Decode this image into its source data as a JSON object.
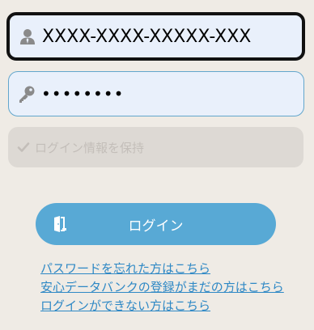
{
  "login_form": {
    "user_id": {
      "value": "XXXX-XXXX-XXXXX-XXX",
      "icon": "user-icon"
    },
    "password": {
      "value": "••••••••",
      "icon": "key-icon"
    },
    "remember": {
      "label": "ログイン情報を保持",
      "checked": false,
      "icon": "check-icon"
    },
    "submit": {
      "label": "ログイン",
      "icon": "door-icon"
    }
  },
  "help_links": [
    {
      "label": "パスワードを忘れた方はこちら"
    },
    {
      "label": "安心データバンクの登録がまだの方はこちら"
    },
    {
      "label": "ログインができない方はこちら"
    }
  ],
  "colors": {
    "background": "#efebe5",
    "field_fill": "#e9f0fb",
    "accent": "#58a9d5",
    "link": "#2e88c5"
  }
}
